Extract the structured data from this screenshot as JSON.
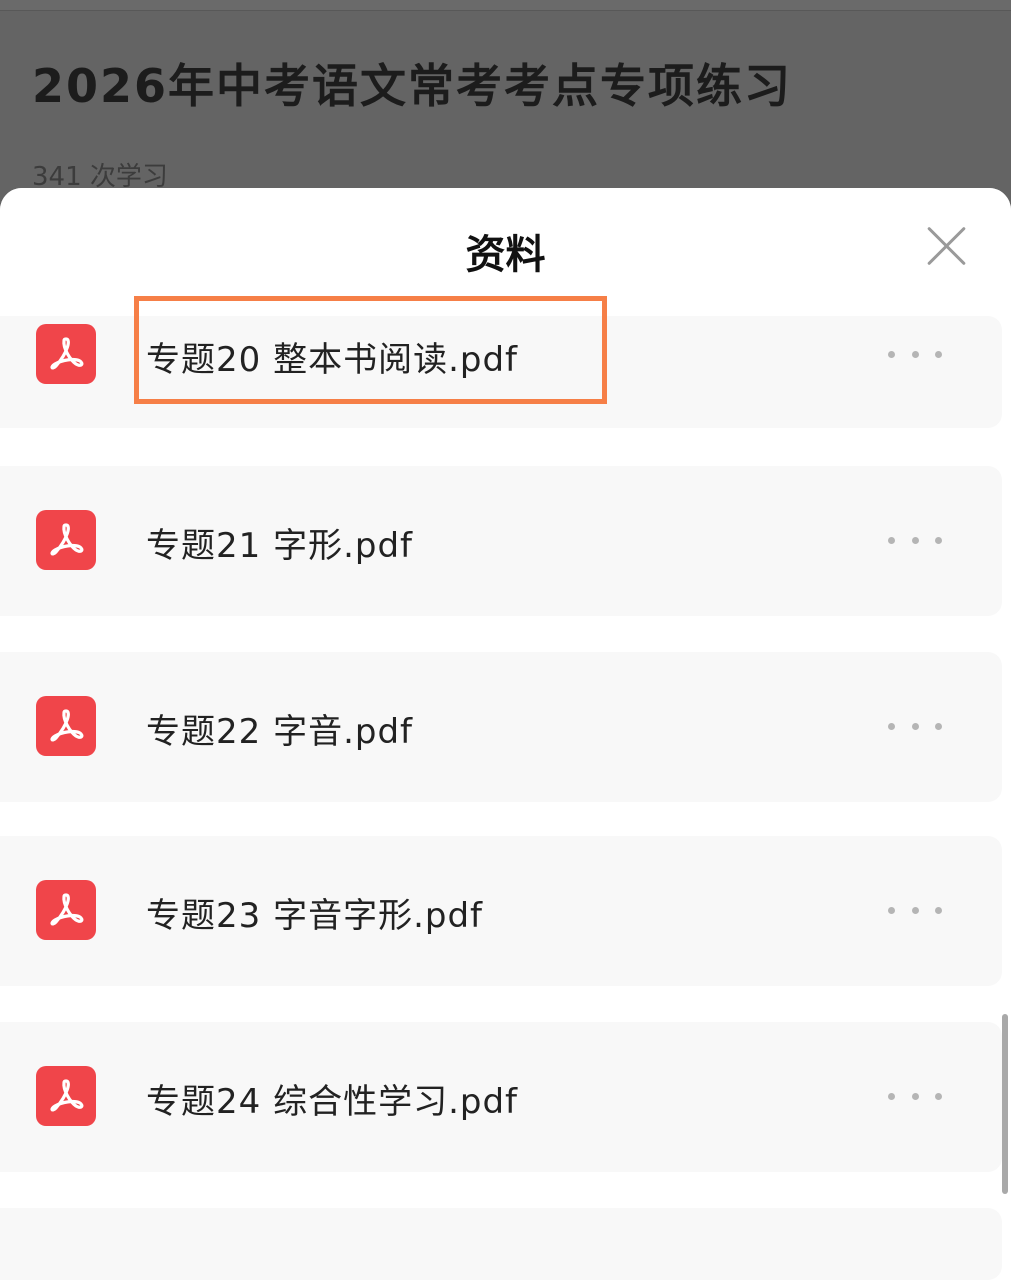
{
  "background": {
    "title": "2026年中考语文常考考点专项练习",
    "study_count": "341 次学习"
  },
  "sheet": {
    "title": "资料",
    "close_icon": "close-icon"
  },
  "files": [
    {
      "name": "专题20 整本书阅读.pdf",
      "icon": "pdf-icon",
      "highlighted": true
    },
    {
      "name": "专题21 字形.pdf",
      "icon": "pdf-icon"
    },
    {
      "name": "专题22 字音.pdf",
      "icon": "pdf-icon"
    },
    {
      "name": "专题23 字音字形.pdf",
      "icon": "pdf-icon"
    },
    {
      "name": "专题24 综合性学习.pdf",
      "icon": "pdf-icon"
    }
  ],
  "colors": {
    "pdf_red": "#f0454a",
    "highlight": "#f67f47"
  }
}
